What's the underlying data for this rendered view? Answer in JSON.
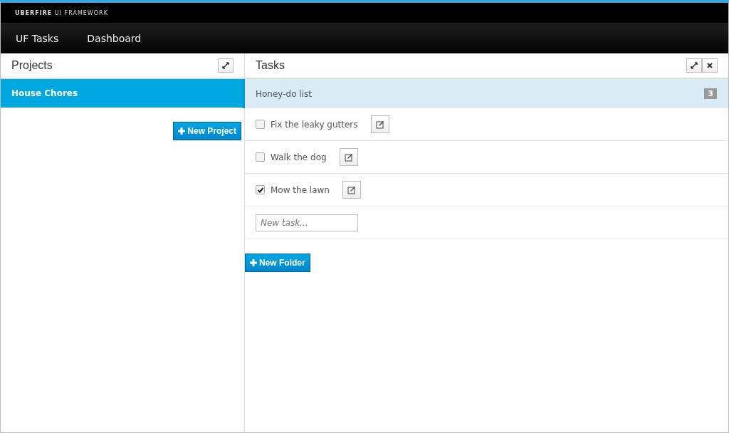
{
  "brand": "**UBERFIRE** UI FRAMEWORK",
  "nav": [
    "UF Tasks",
    "Dashboard"
  ],
  "projects_panel": {
    "title": "Projects",
    "items": [
      {
        "label": "House Chores",
        "selected": true
      }
    ],
    "new_button": "New Project"
  },
  "tasks_panel": {
    "title": "Tasks",
    "folders": [
      {
        "label": "Honey-do list",
        "selected": true,
        "count": "3",
        "tasks": [
          {
            "label": "Fix the leaky gutters",
            "checked": false
          },
          {
            "label": "Walk the dog",
            "checked": false
          },
          {
            "label": "Mow the lawn",
            "checked": true
          }
        ],
        "new_task": {
          "placeholder": "New task..."
        }
      }
    ],
    "new_button": "New Folder"
  }
}
